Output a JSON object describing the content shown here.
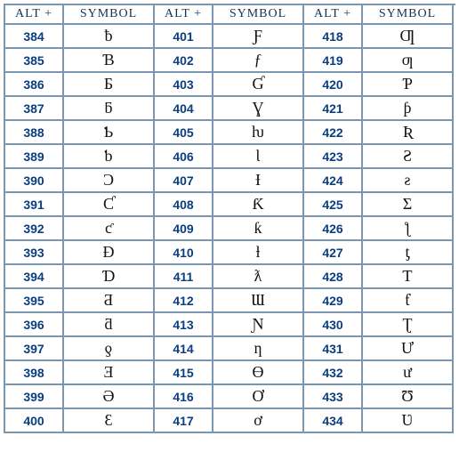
{
  "chart_data": {
    "type": "table",
    "title": "ALT code symbol table",
    "columns": [
      "ALT +",
      "SYMBOL"
    ],
    "blocks": 3,
    "rows_per_block": 17
  },
  "headers": {
    "alt": "ALT +",
    "symbol": "SYMBOL"
  },
  "columns": [
    [
      {
        "alt": "384",
        "sym": "ƀ"
      },
      {
        "alt": "385",
        "sym": "Ɓ"
      },
      {
        "alt": "386",
        "sym": "Ƃ"
      },
      {
        "alt": "387",
        "sym": "ƃ"
      },
      {
        "alt": "388",
        "sym": "Ƅ"
      },
      {
        "alt": "389",
        "sym": "ƅ"
      },
      {
        "alt": "390",
        "sym": "Ɔ"
      },
      {
        "alt": "391",
        "sym": "Ƈ"
      },
      {
        "alt": "392",
        "sym": "ƈ"
      },
      {
        "alt": "393",
        "sym": "Ɖ"
      },
      {
        "alt": "394",
        "sym": "Ɗ"
      },
      {
        "alt": "395",
        "sym": "Ƌ"
      },
      {
        "alt": "396",
        "sym": "ƌ"
      },
      {
        "alt": "397",
        "sym": "ƍ"
      },
      {
        "alt": "398",
        "sym": "Ǝ"
      },
      {
        "alt": "399",
        "sym": "Ə"
      },
      {
        "alt": "400",
        "sym": "Ɛ"
      }
    ],
    [
      {
        "alt": "401",
        "sym": "Ƒ"
      },
      {
        "alt": "402",
        "sym": "ƒ"
      },
      {
        "alt": "403",
        "sym": "Ɠ"
      },
      {
        "alt": "404",
        "sym": "Ɣ"
      },
      {
        "alt": "405",
        "sym": "ƕ"
      },
      {
        "alt": "406",
        "sym": "Ɩ"
      },
      {
        "alt": "407",
        "sym": "Ɨ"
      },
      {
        "alt": "408",
        "sym": "Ƙ"
      },
      {
        "alt": "409",
        "sym": "ƙ"
      },
      {
        "alt": "410",
        "sym": "ƚ"
      },
      {
        "alt": "411",
        "sym": "ƛ"
      },
      {
        "alt": "412",
        "sym": "Ɯ"
      },
      {
        "alt": "413",
        "sym": "Ɲ"
      },
      {
        "alt": "414",
        "sym": "ƞ"
      },
      {
        "alt": "415",
        "sym": "Ɵ"
      },
      {
        "alt": "416",
        "sym": "Ơ"
      },
      {
        "alt": "417",
        "sym": "ơ"
      }
    ],
    [
      {
        "alt": "418",
        "sym": "Ƣ"
      },
      {
        "alt": "419",
        "sym": "ƣ"
      },
      {
        "alt": "420",
        "sym": "Ƥ"
      },
      {
        "alt": "421",
        "sym": "ƥ"
      },
      {
        "alt": "422",
        "sym": "Ʀ"
      },
      {
        "alt": "423",
        "sym": "Ƨ"
      },
      {
        "alt": "424",
        "sym": "ƨ"
      },
      {
        "alt": "425",
        "sym": "Ʃ"
      },
      {
        "alt": "426",
        "sym": "ƪ"
      },
      {
        "alt": "427",
        "sym": "ƫ"
      },
      {
        "alt": "428",
        "sym": "Ƭ"
      },
      {
        "alt": "429",
        "sym": "ƭ"
      },
      {
        "alt": "430",
        "sym": "Ʈ"
      },
      {
        "alt": "431",
        "sym": "Ư"
      },
      {
        "alt": "432",
        "sym": "ư"
      },
      {
        "alt": "433",
        "sym": "Ʊ"
      },
      {
        "alt": "434",
        "sym": "Ʋ"
      }
    ]
  ]
}
